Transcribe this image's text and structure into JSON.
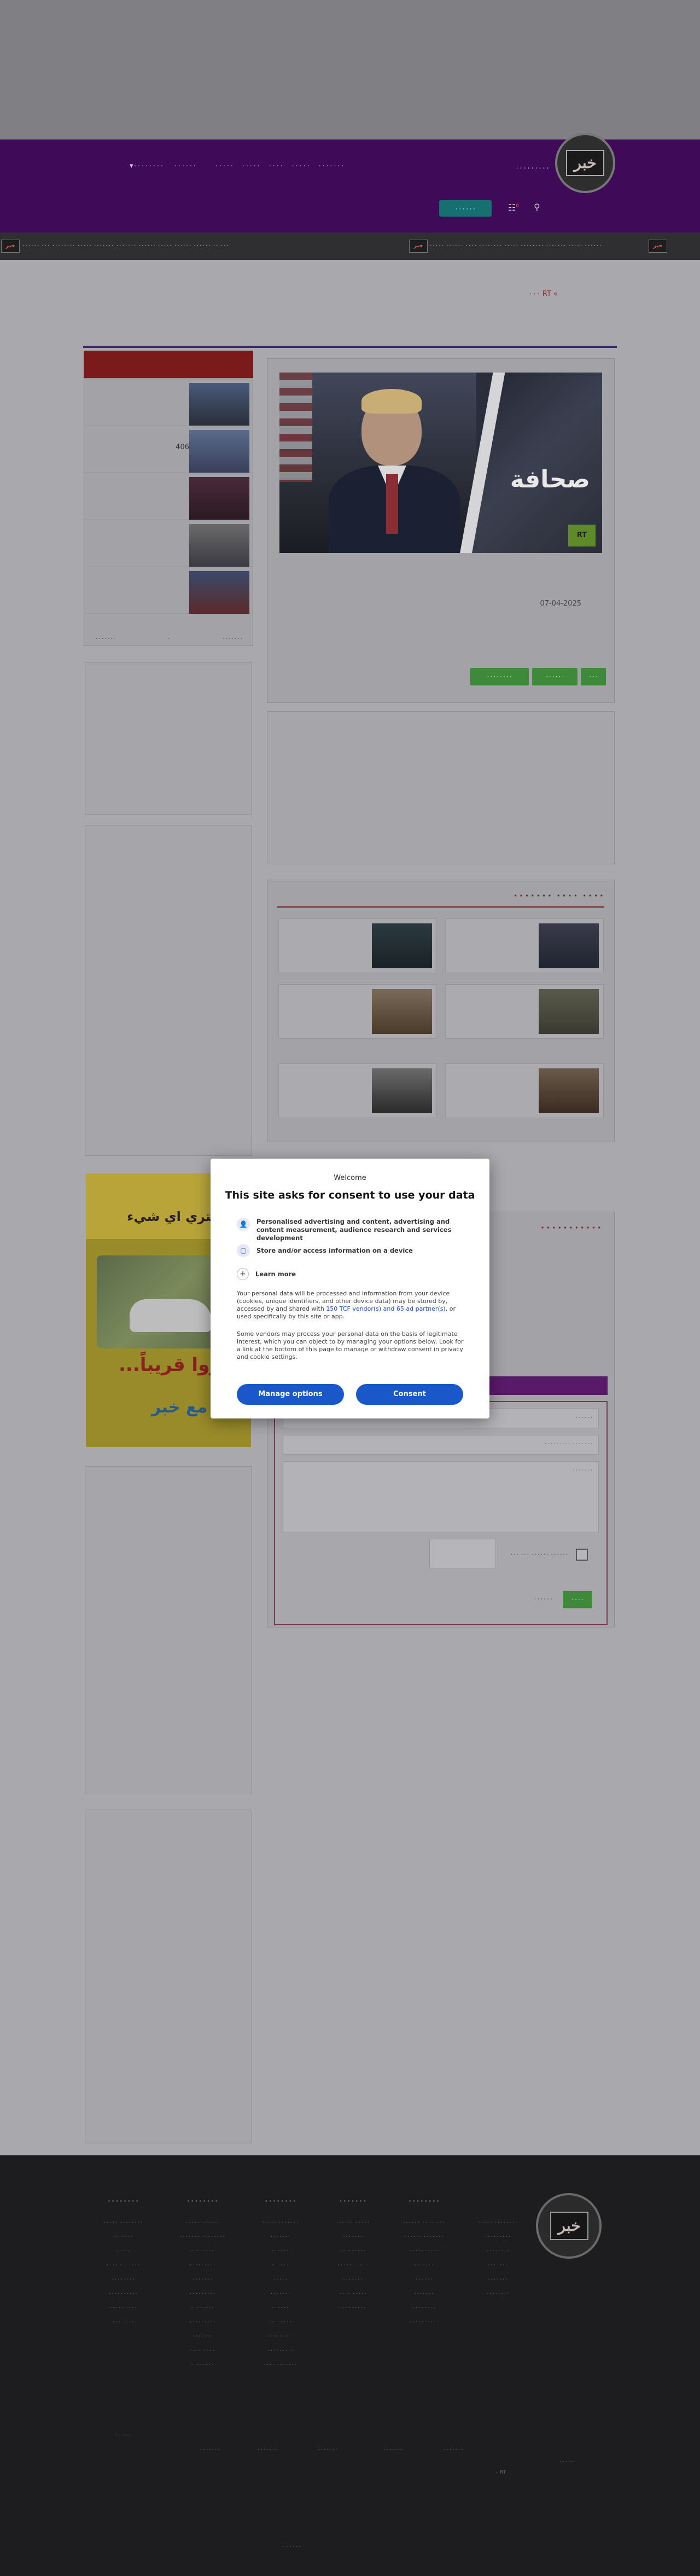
{
  "header": {
    "nav_items": [
      "٠٠٠٠٠٠٠",
      "٠٠٠٠٠",
      "٠٠٠٠",
      "٠٠٠٠٠",
      "٠٠٠٠٠"
    ],
    "nav_more": [
      "▾٠٠٠٠٠٠٠٠",
      "٠٠٠٠٠٠"
    ],
    "nav_top_right": "٠٠٠٠٠٠٠٠٠",
    "live_label": "٠٠٠٠٠٠",
    "cart_count": "0"
  },
  "ticker": {
    "text_1": "٠٠٠ ٠٠ ٠٠٠٠٠٠ ٠٠٠٠٠٠ ٠٠٠٠٠ ٠٠٠٠٠٠ ٠٠٠٠٠٠٠ ٠٠٠٠٠٠٠ ٠٠٠٠٠ ٠٠٠٠٠٠٠٠ ٠٠٠ ٠٠٠٠٠٠",
    "text_2": "٠٠٠٠٠٠ ٠٠٠٠٠ ٠٠٠٠٠٠٠ ٠٠٠٠٠٠٠٠ ٠٠٠٠٠ ٠٠٠٠٠٠٠٠ ٠٠٠٠ ٠٠٠٠٠٠ ٠٠٠٠٠",
    "logo": "خبر"
  },
  "breadcrumb": "٠٠٠ RT «",
  "side_list": {
    "count": "406",
    "foot_left": "٠٠٠٠٠٠٠",
    "foot_mid": "٠",
    "foot_right": "٠٠٠٠٠٠٠"
  },
  "article": {
    "hero_word": "صحافة",
    "hero_badge": "RT",
    "date": "07-04-2025",
    "buttons": [
      "٠٠٠٠٠٠٠٠",
      "٠٠٠٠٠٠",
      "٠٠٠"
    ]
  },
  "related": {
    "title": "٠٠٠٠ ٠٠٠٠ ٠٠٠٠٠٠٠"
  },
  "poster": {
    "line1": "و اشتري اي شيء",
    "line2": "...نظروا قريباً",
    "line3": "مع خبر"
  },
  "comments": {
    "title": "٠٠٠٠٠٠٠٠٠٠٠",
    "field_name": "٠٠٠٠٠٠",
    "field_email": "٠٠٠٠٠٠٠ ٠٠٠٠٠٠٠٠٠",
    "field_body": "٠٠٠٠٠٠٠",
    "checkbox_label": "٠٠٠٠٠٠ ٠٠٠٠٠٠ ٠٠٠ ٠٠٠",
    "send": "٠٠٠٠",
    "cancel": "٠٠٠٠٠٠"
  },
  "footer": {
    "columns": [
      {
        "head": "٠٠٠٠٠٠٠٠",
        "links": [
          "٠٠٠٠٠٠٠٠ ٠٠٠٠٠",
          "٠٠٠٠٠٠٠",
          "٠٠٠٠٠",
          "٠٠٠٠٠٠٠ ٠٠٠٠",
          "٠٠٠٠٠٠٠٠",
          "٠٠٠٠٠٠٠٠٠٠",
          "٠٠٠٠ ٠٠٠٠٠",
          "٠٠٠٠ ٠٠٠"
        ]
      },
      {
        "head": "٠٠٠٠٠٠٠٠",
        "links": [
          "٠٠٠٠٠٠ ٠٠٠٠٠",
          "٠٠٠٠٠٠٠٠ ٠٠٠٠٠٠٠",
          "٠٠٠٠٠٠٠٠",
          "٠٠٠٠٠٠٠٠٠",
          "٠٠٠٠٠٠٠",
          "٠٠٠٠٠٠٠٠٠",
          "٠٠٠٠٠٠٠٠",
          "٠٠٠٠٠٠٠٠٠",
          "٠٠٠٠٠٠٠",
          "٠٠٠٠ ٠٠٠٠",
          "٠٠٠٠٠٠٠٠"
        ]
      },
      {
        "head": "٠٠٠٠٠٠٠٠",
        "links": [
          "٠٠٠٠٠٠٠ ٠٠٠٠٠",
          "٠٠٠٠٠٠٠",
          "٠٠٠٠٠٠",
          "٠٠٠٠٠٠",
          "٠٠٠٠٠",
          "٠٠٠٠٠٠٠",
          "٠٠٠٠٠٠",
          "٠٠٠٠٠٠٠٠",
          "٠٠٠٠٠ ٠٠٠٠",
          "٠٠٠٠٠٠٠٠٠",
          "٠٠٠٠٠٠٠ ٠٠٠٠"
        ]
      },
      {
        "head": "٠٠٠٠٠٠٠",
        "links": [
          "٠٠٠٠٠ ٠٠٠٠٠٠",
          "٠٠٠٠٠٠٠",
          "٠٠٠٠٠٠٠٠٠",
          "٠٠٠٠٠ ٠٠٠٠٠",
          "٠٠٠٠٠٠٠",
          "٠٠٠٠٠ ٠٠٠٠",
          "٠٠٠٠٠٠٠٠٠"
        ]
      },
      {
        "head": "٠٠٠٠٠٠٠٠",
        "links": [
          "٠٠٠٠٠٠٠٠ ٠٠٠٠٠٠",
          "٠٠٠٠٠٠٠ ٠٠٠٠٠٠",
          "٠٠٠٠٠٠٠٠٠٠",
          "٠٠٠٠٠٠٠",
          "٠٠٠٠٠٠",
          "٠٠٠٠٠٠٠",
          "٠٠٠٠٠٠٠٠",
          "٠٠٠٠٠٠٠٠٠٠"
        ]
      },
      {
        "head": "",
        "links": [
          "٠٠٠٠٠٠٠٠ ٠٠٠٠٠",
          "٠٠٠٠٠٠٠٠٠",
          "٠٠٠٠٠٠٠٠",
          "٠٠٠٠٠٠٠",
          "٠٠٠٠٠٠٠",
          "٠٠٠٠٠٠٠٠"
        ]
      }
    ],
    "bottom_links": [
      "٠٠٠٠٠٠٠",
      "٠٠٠٠٠٠٠",
      "٠٠٠٠٠٠٠",
      "٠٠٠٠٠٠٠",
      "٠٠٠٠٠٠٠",
      "٠٠٠٠٠٠٠"
    ],
    "small_1": "٠٠٠٠٠",
    "small_2": "٠٠٠٠٠٠",
    "rt": "٠ RT",
    "copyright": "٠٠٠٠٠ ٠"
  },
  "consent": {
    "welcome": "Welcome",
    "title": "This site asks for consent to use your data",
    "purpose_1": "Personalised advertising and content, advertising and content measurement, audience research and services development",
    "purpose_2": "Store and/or access information on a device",
    "learn_more": "Learn more",
    "para_1_start": "Your personal data will be processed and information from your device (cookies, unique identifiers, and other device data) may be stored by, accessed by and shared with ",
    "para_1_link": "150 TCF vendor(s) and 65 ad partner(s)",
    "para_1_end": ", or used specifically by this site or app.",
    "para_2": "Some vendors may process your personal data on the basis of legitimate interest, which you can object to by managing your options below. Look for a link at the bottom of this page to manage or withdraw consent in privacy and cookie settings.",
    "manage_btn": "Manage options",
    "consent_btn": "Consent"
  }
}
